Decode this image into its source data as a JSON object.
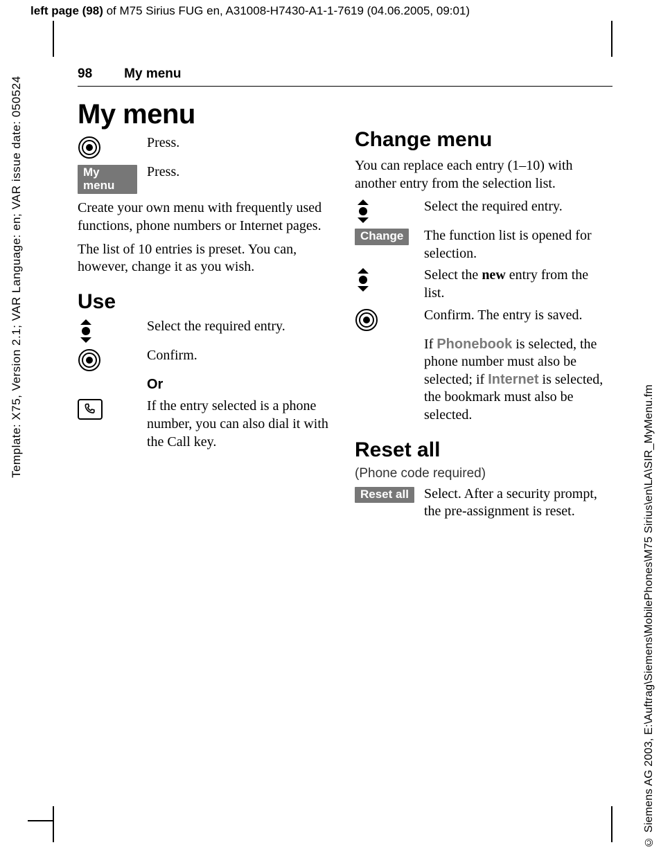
{
  "meta": {
    "top_prefix_bold": "left page (98)",
    "top_rest": " of M75 Sirius FUG en, A31008-H7430-A1-1-7619 (04.06.2005, 09:01)",
    "left": "Template: X75, Version 2.1; VAR Language: en; VAR issue date: 050524",
    "right": "© Siemens AG 2003, E:\\Auftrag\\Siemens\\MobilePhones\\M75 Sirius\\en\\LA\\SIR_MyMenu.fm"
  },
  "header": {
    "page_number": "98",
    "running_title": "My menu"
  },
  "left_col": {
    "h1": "My menu",
    "press1": "Press.",
    "softkey_mymenu": "My menu",
    "press2": "Press.",
    "intro1": "Create your own menu with frequently used functions, phone numbers or Internet pages.",
    "intro2": "The list of 10 entries is preset. You can, however, change it as you wish.",
    "h2_use": "Use",
    "use_select": "Select the required entry.",
    "use_confirm": "Confirm.",
    "use_or": "Or",
    "use_call": "If the entry selected is a phone number, you can also dial it with the Call key."
  },
  "right_col": {
    "h2_change": "Change menu",
    "change_intro": "You can replace each entry (1–10) with another entry from the selection list.",
    "change_select": "Select the required entry.",
    "softkey_change": "Change",
    "change_open": "The function list is opened for selection.",
    "change_new_pre": "Select the ",
    "change_new_bold": "new",
    "change_new_post": " entry from the list.",
    "change_confirm": "Confirm. The entry is saved.",
    "change_note_pre": "If ",
    "change_note_pb": "Phonebook",
    "change_note_mid": " is selected, the phone number must also be selected; if ",
    "change_note_int": "Internet",
    "change_note_post": " is selected, the bookmark must also be selected.",
    "h2_reset": "Reset all",
    "reset_sub": "(Phone code required)",
    "softkey_reset": "Reset all",
    "reset_text": "Select. After a security prompt, the pre-assignment is reset."
  }
}
